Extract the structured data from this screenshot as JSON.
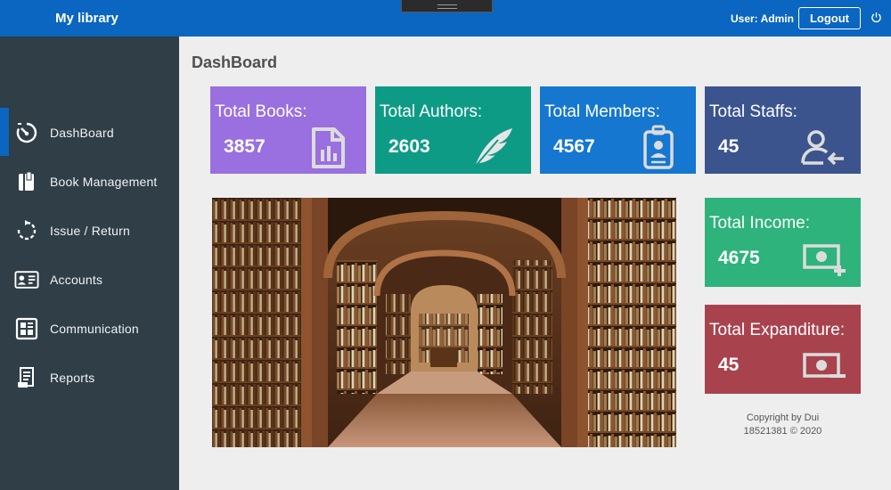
{
  "header": {
    "title": "My library",
    "user_label": "User: Admin",
    "logout_label": "Logout"
  },
  "sidebar": {
    "items": [
      {
        "label": "DashBoard",
        "icon": "dashboard-icon",
        "active": true
      },
      {
        "label": "Book Management",
        "icon": "book-icon"
      },
      {
        "label": "Issue / Return",
        "icon": "refresh-icon"
      },
      {
        "label": "Accounts",
        "icon": "id-card-icon"
      },
      {
        "label": "Communication",
        "icon": "newspaper-icon"
      },
      {
        "label": "Reports",
        "icon": "report-icon"
      }
    ]
  },
  "main": {
    "title": "DashBoard",
    "cards": [
      {
        "title": "Total Books:",
        "value": "3857",
        "icon": "report-chart-icon",
        "color": "#9a6fe0"
      },
      {
        "title": "Total Authors:",
        "value": "2603",
        "icon": "feather-icon",
        "color": "#0e9b86"
      },
      {
        "title": "Total Members:",
        "value": "4567",
        "icon": "id-badge-icon",
        "color": "#1577d0"
      },
      {
        "title": "Total Staffs:",
        "value": "45",
        "icon": "user-arrow-icon",
        "color": "#3b548e"
      },
      {
        "title": "Total Income:",
        "value": "4675",
        "icon": "money-plus-icon",
        "color": "#2db37b"
      },
      {
        "title": "Total Expanditure:",
        "value": "45",
        "icon": "money-minus-icon",
        "color": "#a8434e"
      }
    ],
    "copyright_line1": "Copyright by Dui",
    "copyright_line2": "18521381 © 2020"
  },
  "colors": {
    "header": "#0a66c0",
    "sidebar": "#2f3e47",
    "background": "#eeeeee"
  }
}
